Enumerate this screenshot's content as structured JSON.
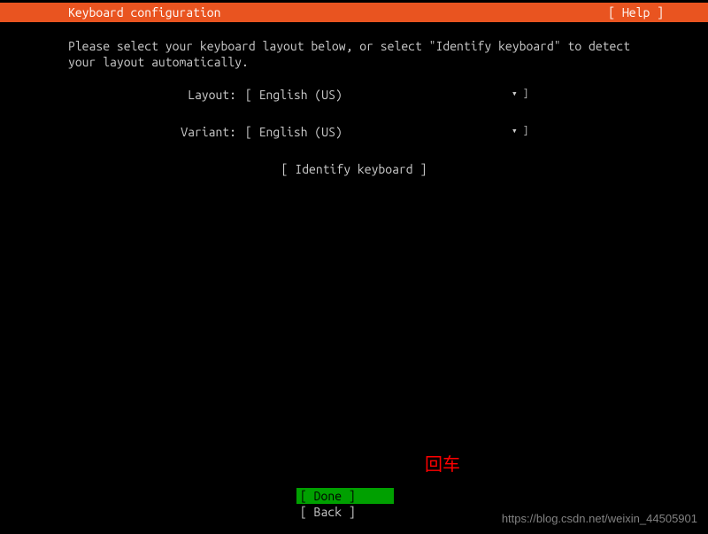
{
  "header": {
    "title": "Keyboard configuration",
    "help": "[ Help ]"
  },
  "instruction": "Please select your keyboard layout below, or select \"Identify keyboard\" to detect your layout automatically.",
  "fields": {
    "layout": {
      "label": "Layout:",
      "value": "[ English (US)",
      "suffix": "▾ ]"
    },
    "variant": {
      "label": "Variant:",
      "value": "[ English (US)",
      "suffix": "▾ ]"
    }
  },
  "identify": "[ Identify keyboard ]",
  "annotation": "回车",
  "buttons": {
    "done": "[ Done       ]",
    "back": "[ Back       ]"
  },
  "watermark": "https://blog.csdn.net/weixin_44505901"
}
